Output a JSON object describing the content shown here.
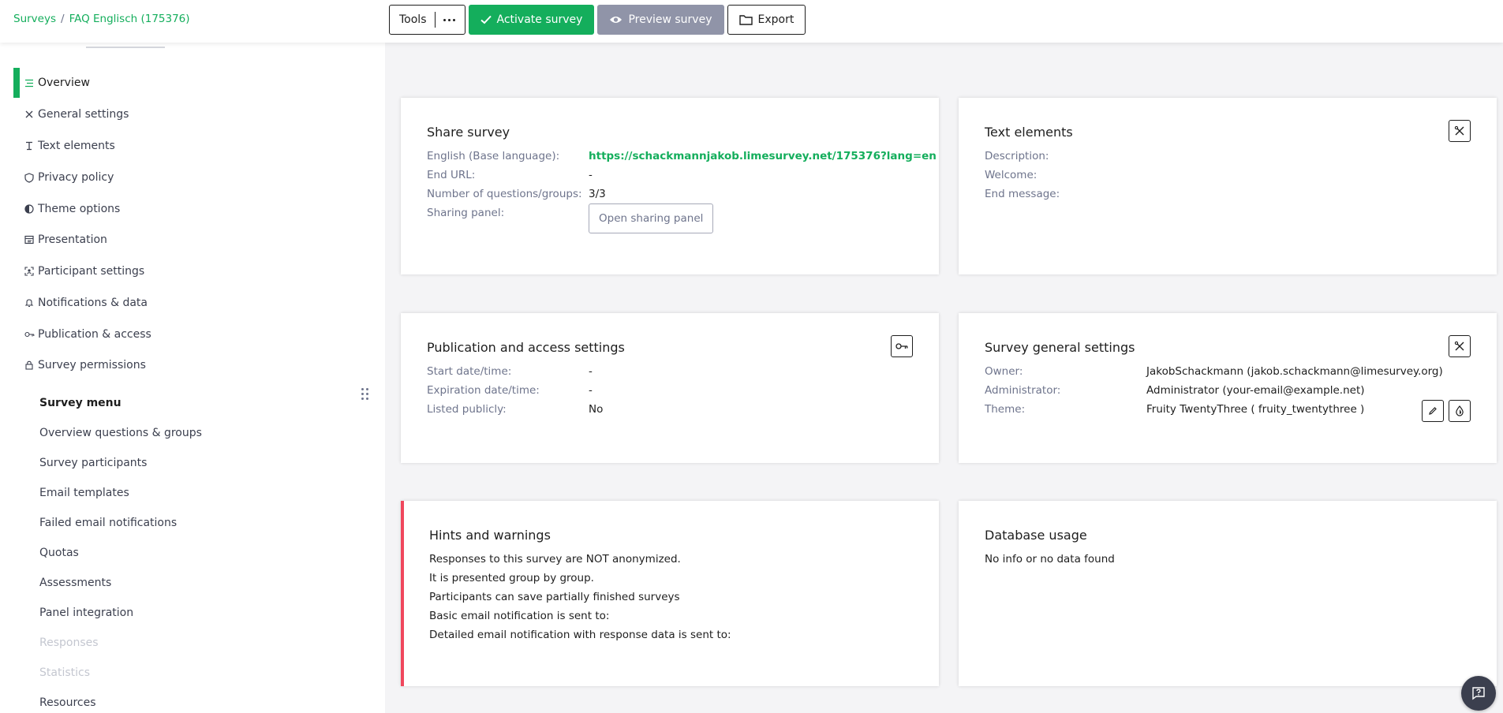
{
  "breadcrumb": {
    "root": "Surveys",
    "separator": "/",
    "current": "FAQ Englisch (175376)"
  },
  "toolbar": {
    "tools_label": "Tools",
    "activate_label": "Activate survey",
    "preview_label": "Preview survey",
    "export_label": "Export"
  },
  "sidebar": {
    "settings_items": [
      {
        "label": "Overview",
        "icon": "list-icon"
      },
      {
        "label": "General settings",
        "icon": "tools-icon"
      },
      {
        "label": "Text elements",
        "icon": "text-cursor-icon"
      },
      {
        "label": "Privacy policy",
        "icon": "shield-icon"
      },
      {
        "label": "Theme options",
        "icon": "contrast-icon"
      },
      {
        "label": "Presentation",
        "icon": "layout-icon"
      },
      {
        "label": "Participant settings",
        "icon": "user-focus-icon"
      },
      {
        "label": "Notifications & data",
        "icon": "bell-icon"
      },
      {
        "label": "Publication & access",
        "icon": "key-icon"
      },
      {
        "label": "Survey permissions",
        "icon": "lock-icon"
      }
    ],
    "menu_title": "Survey menu",
    "menu_items": [
      {
        "label": "Overview questions & groups"
      },
      {
        "label": "Survey participants"
      },
      {
        "label": "Email templates"
      },
      {
        "label": "Failed email notifications"
      },
      {
        "label": "Quotas"
      },
      {
        "label": "Assessments"
      },
      {
        "label": "Panel integration"
      },
      {
        "label": "Responses"
      },
      {
        "label": "Statistics"
      },
      {
        "label": "Resources"
      }
    ]
  },
  "share": {
    "title": "Share survey",
    "rows": [
      {
        "label": "English (Base language):",
        "value": "https://schackmannjakob.limesurvey.net/175376?lang=en"
      },
      {
        "label": "End URL:",
        "value": "-"
      },
      {
        "label": "Number of questions/groups:",
        "value": "3/3"
      },
      {
        "label": "Sharing panel:",
        "value": ""
      }
    ],
    "panel_button": "Open sharing panel"
  },
  "text_elements": {
    "title": "Text elements",
    "rows": [
      {
        "label": "Description:",
        "value": ""
      },
      {
        "label": "Welcome:",
        "value": ""
      },
      {
        "label": "End message:",
        "value": ""
      }
    ]
  },
  "publication": {
    "title": "Publication and access settings",
    "rows": [
      {
        "label": "Start date/time:",
        "value": "-"
      },
      {
        "label": "Expiration date/time:",
        "value": "-"
      },
      {
        "label": "Listed publicly:",
        "value": "No"
      }
    ]
  },
  "general": {
    "title": "Survey general settings",
    "rows": [
      {
        "label": "Owner:",
        "value": "JakobSchackmann (jakob.schackmann@limesurvey.org)"
      },
      {
        "label": "Administrator:",
        "value": "Administrator (your-email@example.net)"
      },
      {
        "label": "Theme:",
        "value": "Fruity TwentyThree ( fruity_twentythree )"
      }
    ]
  },
  "hints": {
    "title": "Hints and warnings",
    "lines": [
      "Responses to this survey are NOT anonymized.",
      "It is presented group by group.",
      "Participants can save partially finished surveys",
      "Basic email notification is sent to:",
      "Detailed email notification with response data is sent to:"
    ]
  },
  "database": {
    "title": "Database usage",
    "message": "No info or no data found"
  },
  "colors": {
    "accent": "#14ae5c",
    "warning": "#f0475d",
    "muted": "#6e748c",
    "preview": "#9094a8"
  }
}
